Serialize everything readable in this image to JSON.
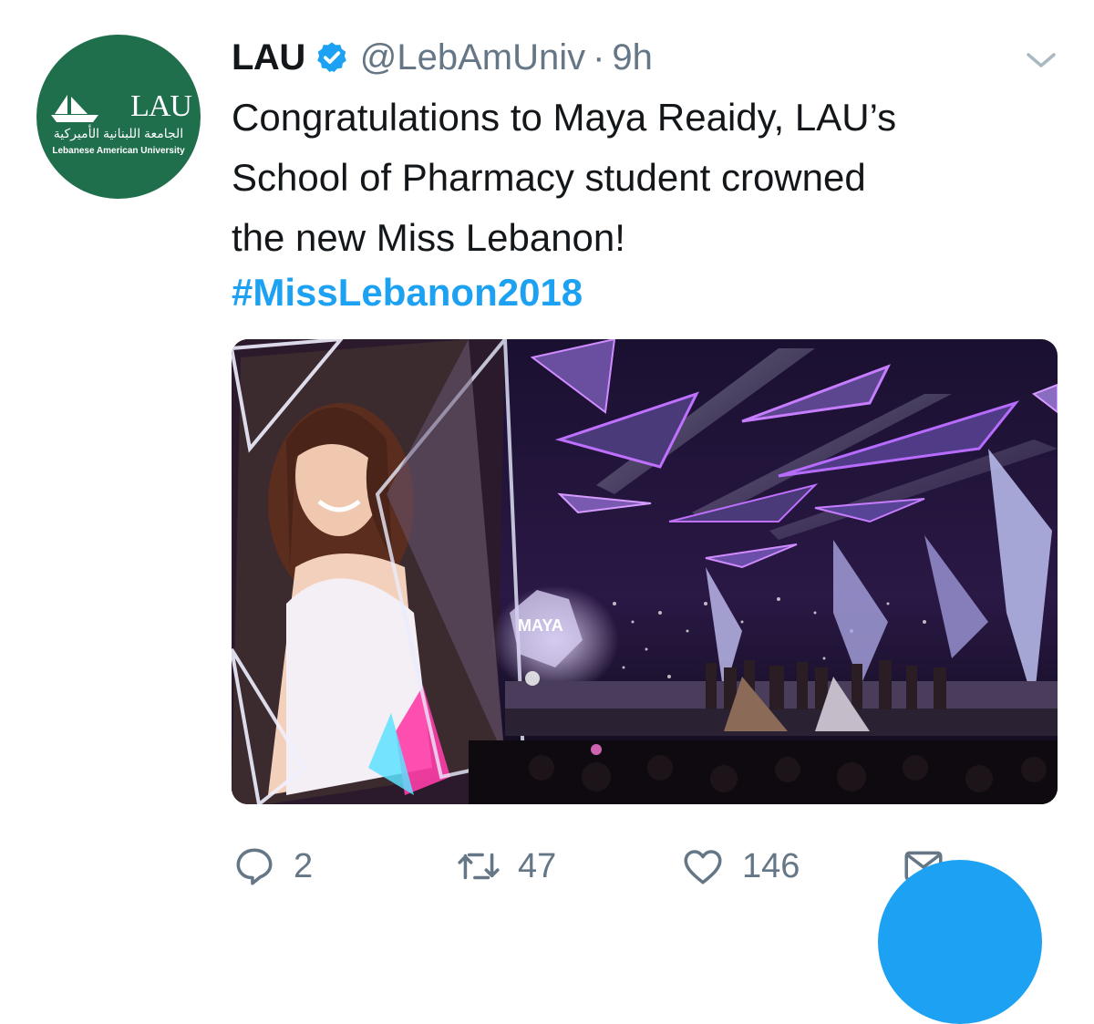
{
  "account": {
    "avatar_logo_text": "LAU",
    "avatar_arabic": "الجامعة اللبنانية الأميركية",
    "avatar_subtitle": "Lebanese American University",
    "name": "LAU",
    "handle": "@LebAmUniv",
    "separator": "·",
    "time": "9h",
    "verified": true
  },
  "tweet": {
    "text_lines": [
      "Congratulations to Maya Reaidy, LAU’s",
      "School of Pharmacy student crowned",
      "the new Miss Lebanon!"
    ],
    "hashtag": "#MissLebanon2018",
    "hashtag_color": "#1da1f2"
  },
  "media": {
    "screen_text": "MAYA"
  },
  "actions": {
    "reply_count": "2",
    "retweet_count": "47",
    "like_count": "146"
  },
  "icons": {
    "verified": "verified-badge-icon",
    "menu": "chevron-down-icon",
    "reply": "reply-icon",
    "retweet": "retweet-icon",
    "like": "heart-icon",
    "message": "envelope-icon"
  },
  "colors": {
    "brand_blue": "#1da1f2",
    "secondary_text": "#657786",
    "avatar_green": "#1f6e4c"
  }
}
